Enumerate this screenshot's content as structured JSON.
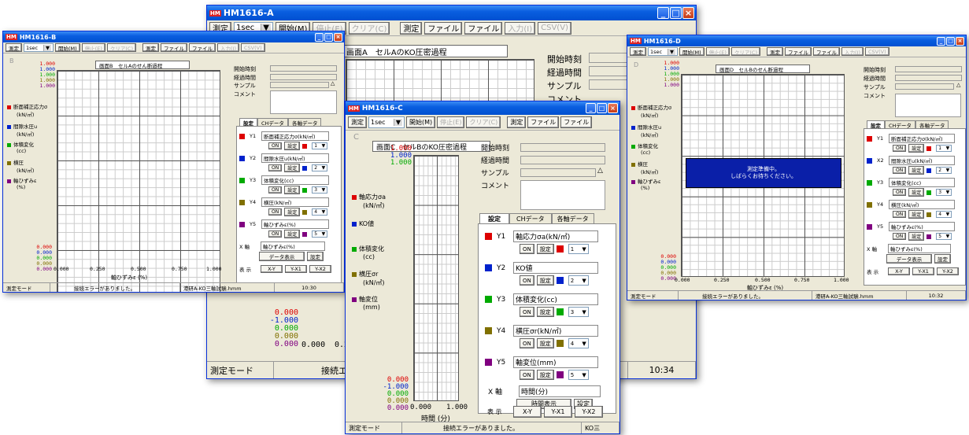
{
  "common": {
    "measure": "測定",
    "interval": "1sec",
    "arrow": "▼",
    "start": "開始(M)",
    "stop": "停止(E)",
    "clear": "クリア(C)",
    "measure_tab": "測定",
    "file_tab": "ファイル",
    "file_btn": "ファイル",
    "input": "入力(I)",
    "csv": "CSV(V)",
    "start_time": "開始時刻",
    "elapsed": "経過時間",
    "sample": "サンプル",
    "comment": "コメント",
    "setting": "設定",
    "ch_data": "CHデータ",
    "axis_data": "各軸データ",
    "on": "ON",
    "x_axis": "X 軸",
    "display": "表 示",
    "xy": "X-Y",
    "yx1": "Y-X1",
    "yx2": "Y-X2",
    "mode": "測定モード",
    "error": "接続エラーがありました。",
    "up": "△"
  },
  "winA": {
    "title": "HM1616-A",
    "chart_title": "画面A　セルAのKO圧密過程",
    "y_labels": [
      "0.000",
      "-1.000",
      "0.000",
      "0.000",
      "0.000"
    ],
    "x_labels": [
      "0.000",
      "0.2"
    ],
    "time": "10:34"
  },
  "winB": {
    "title": "HM1616-B",
    "corner": "B",
    "chart_title": "画面B　セルAのせん断過程",
    "y_top": [
      "1.000",
      "1.000",
      "1.000",
      "1.000",
      "1.000"
    ],
    "y_bottom": [
      "0.000",
      "0.000",
      "0.000",
      "0.000",
      "0.000"
    ],
    "x_labels": [
      "0.000",
      "0.250",
      "0.500",
      "0.750",
      "1.000"
    ],
    "xaxis_label": "軸ひずみε (%)",
    "legend": [
      {
        "name": "断面補正応力σ",
        "unit": "(kN/㎡)",
        "color": "#dd0000"
      },
      {
        "name": "間隙水圧u",
        "unit": "(kN/㎡)",
        "color": "#0022cc"
      },
      {
        "name": "体積変化",
        "unit": "(cc)",
        "color": "#00aa00"
      },
      {
        "name": "横圧",
        "unit": "(kN/㎡)",
        "color": "#807000"
      },
      {
        "name": "軸ひずみε",
        "unit": "(%)",
        "color": "#800080"
      }
    ],
    "channels": [
      {
        "id": "Y1",
        "name": "断面補正応力σ(kN/㎡)",
        "num": "1",
        "color": "#dd0000"
      },
      {
        "id": "Y2",
        "name": "間隙水圧u(kN/㎡)",
        "num": "2",
        "color": "#0022cc"
      },
      {
        "id": "Y3",
        "name": "体積変化(cc)",
        "num": "3",
        "color": "#00aa00"
      },
      {
        "id": "Y4",
        "name": "横圧(kN/㎡)",
        "num": "4",
        "color": "#807000"
      },
      {
        "id": "Y5",
        "name": "軸ひずみε(%)",
        "num": "5",
        "color": "#800080"
      }
    ],
    "x_channel": "軸ひずみε(%)",
    "x_btn": "データ表示",
    "file": "港研A-KO三軸試験.hmm",
    "time": "10:30"
  },
  "winC": {
    "title": "HM1616-C",
    "corner": "C",
    "chart_title": "画面C　セルBのKO圧密過程",
    "y_top": [
      "1.000",
      "1.000",
      "1.000"
    ],
    "y_bottom": [
      "0.000",
      "-1.000",
      "0.000",
      "0.000",
      "0.000"
    ],
    "x_labels": [
      "0.000",
      "1.000"
    ],
    "xaxis_label": "時間 (分)",
    "legend": [
      {
        "name": "軸応力σa",
        "unit": "(kN/㎡)",
        "color": "#dd0000"
      },
      {
        "name": "KO値",
        "unit": "",
        "color": "#0022cc"
      },
      {
        "name": "体積変化",
        "unit": "(cc)",
        "color": "#00aa00"
      },
      {
        "name": "横圧σr",
        "unit": "(kN/㎡)",
        "color": "#807000"
      },
      {
        "name": "軸変位",
        "unit": "(mm)",
        "color": "#800080"
      }
    ],
    "channels": [
      {
        "id": "Y1",
        "name": "軸応力σa(kN/㎡)",
        "num": "1",
        "color": "#dd0000"
      },
      {
        "id": "Y2",
        "name": "KO値",
        "num": "2",
        "color": "#0022cc"
      },
      {
        "id": "Y3",
        "name": "体積変化(cc)",
        "num": "3",
        "color": "#00aa00"
      },
      {
        "id": "Y4",
        "name": "横圧σr(kN/㎡)",
        "num": "4",
        "color": "#807000"
      },
      {
        "id": "Y5",
        "name": "軸変位(mm)",
        "num": "5",
        "color": "#800080"
      }
    ],
    "x_channel": "時間(分)",
    "x_btn": "時間表示",
    "file": "KO三"
  },
  "winD": {
    "title": "HM1616-D",
    "corner": "D",
    "chart_title": "画面D　セルBのせん断過程",
    "y_top": [
      "1.000",
      "1.000",
      "1.000",
      "1.000",
      "1.000"
    ],
    "y_bottom": [
      "0.000",
      "0.000",
      "0.000",
      "0.000",
      "0.000"
    ],
    "x_labels": [
      "0.000",
      "0.250",
      "0.500",
      "0.750",
      "1.000"
    ],
    "xaxis_label": "軸ひずみε (%)",
    "overlay_line1": "測定準備中。",
    "overlay_line2": "しばらくお待ちください。",
    "legend": [
      {
        "name": "断面補正応力σ",
        "unit": "(kN/㎡)",
        "color": "#dd0000"
      },
      {
        "name": "間隙水圧u",
        "unit": "(kN/㎡)",
        "color": "#0022cc"
      },
      {
        "name": "体積変化",
        "unit": "(cc)",
        "color": "#00aa00"
      },
      {
        "name": "横圧",
        "unit": "(kN/㎡)",
        "color": "#807000"
      },
      {
        "name": "軸ひずみε",
        "unit": "(%)",
        "color": "#800080"
      }
    ],
    "channels": [
      {
        "id": "Y1",
        "name": "断面補正応力σ(kN/㎡)",
        "num": "1",
        "color": "#dd0000"
      },
      {
        "id": "X2",
        "name": "間隙水圧u(kN/㎡)",
        "num": "2",
        "color": "#0022cc"
      },
      {
        "id": "Y3",
        "name": "体積変化(cc)",
        "num": "3",
        "color": "#00aa00"
      },
      {
        "id": "Y4",
        "name": "横圧(kN/㎡)",
        "num": "4",
        "color": "#807000"
      },
      {
        "id": "Y5",
        "name": "軸ひずみε(%)",
        "num": "5",
        "color": "#800080"
      }
    ],
    "x_channel": "軸ひずみε(%)",
    "x_btn": "データ表示",
    "file": "港研A-KO三軸試験.hmm",
    "time": "10:32"
  }
}
